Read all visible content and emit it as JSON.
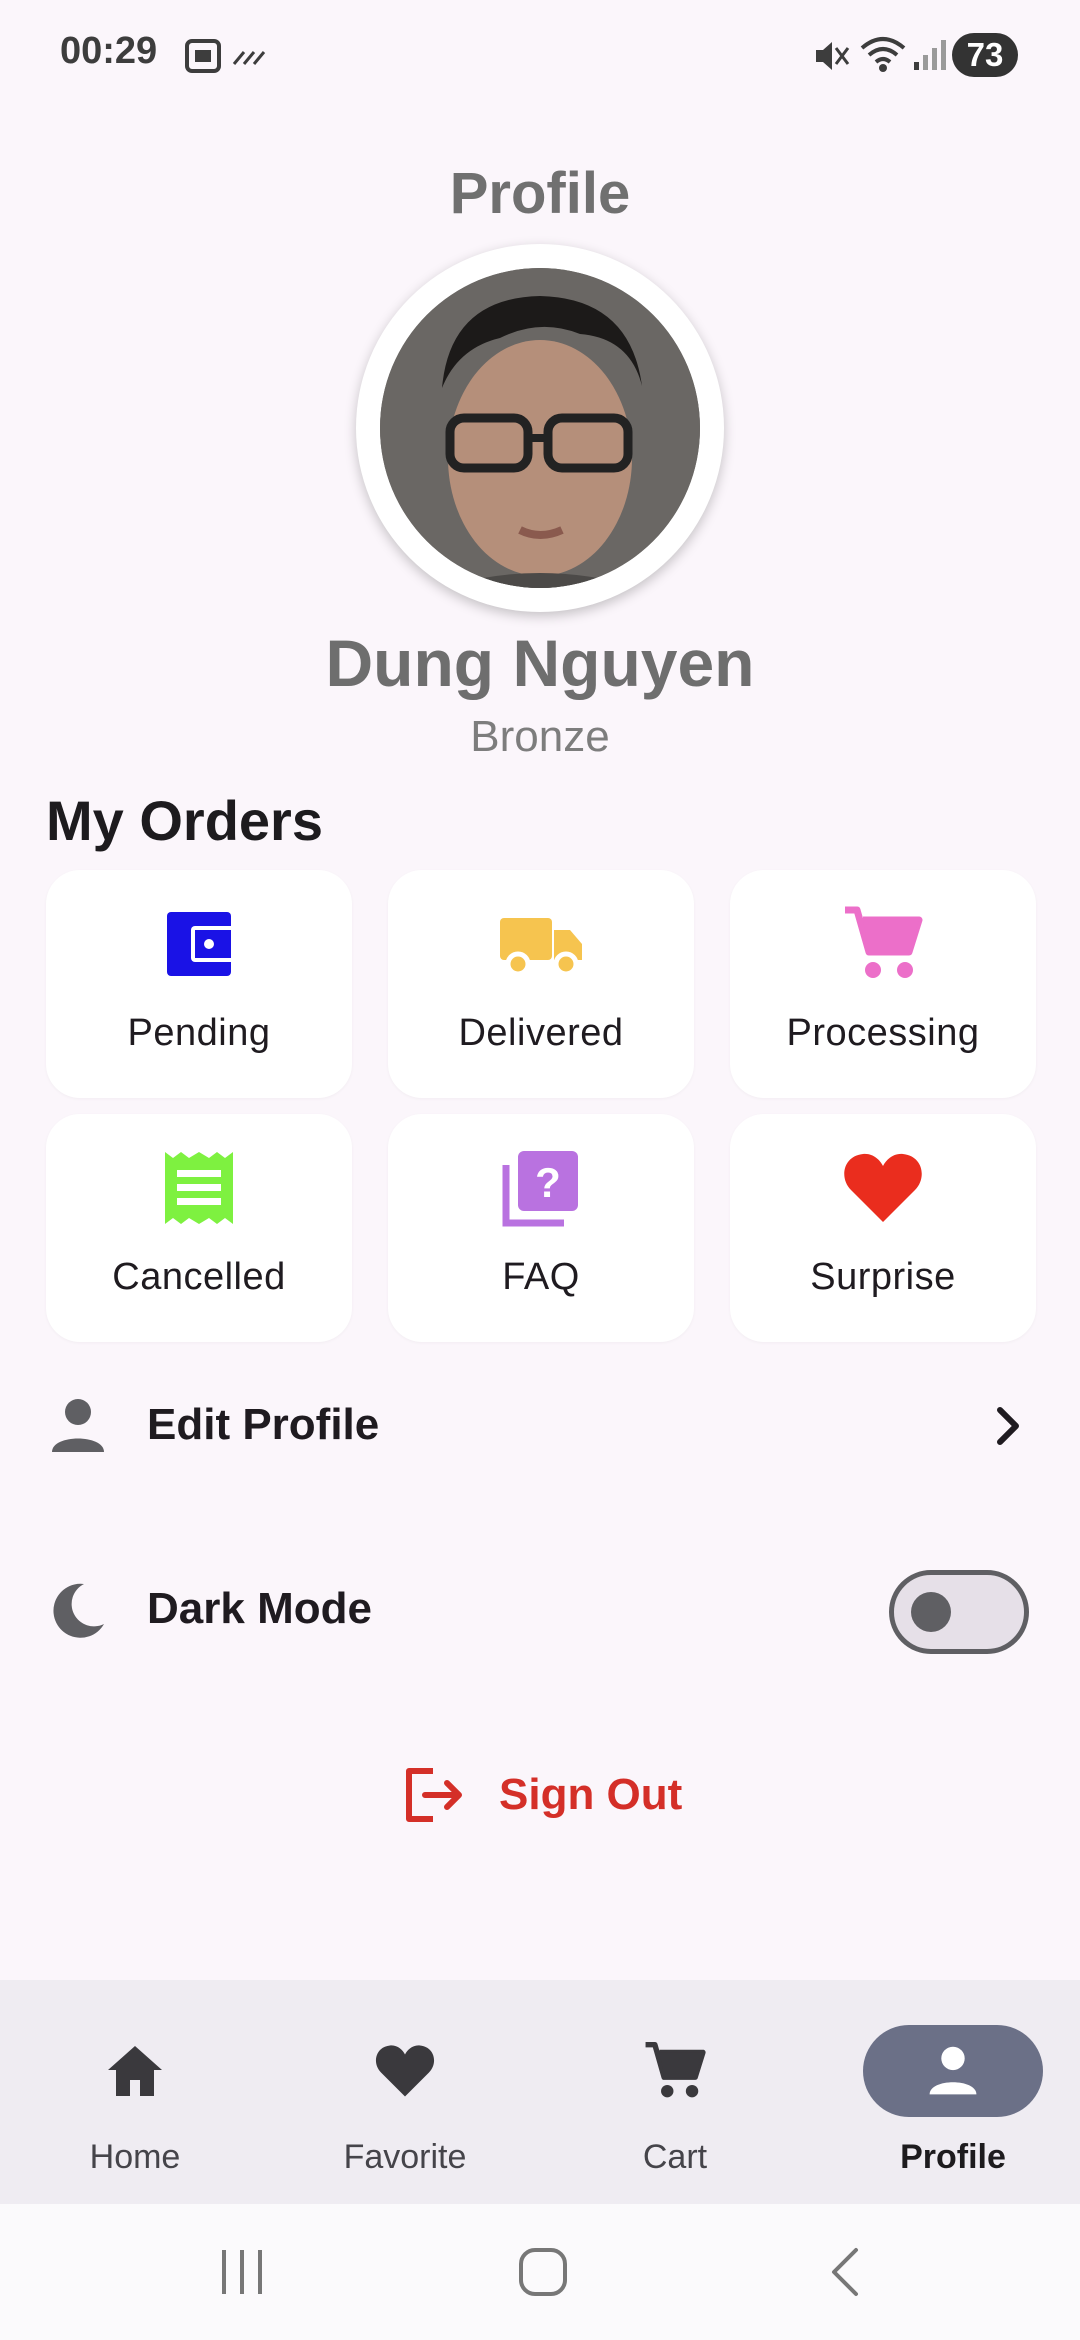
{
  "status_bar": {
    "time": "00:29",
    "battery": "73"
  },
  "header": {
    "title": "Profile"
  },
  "user": {
    "name": "Dung Nguyen",
    "tier": "Bronze"
  },
  "orders": {
    "title": "My Orders",
    "items": [
      {
        "label": "Pending",
        "icon": "wallet-icon",
        "color": "#1a12e6"
      },
      {
        "label": "Delivered",
        "icon": "truck-icon",
        "color": "#f6c44f"
      },
      {
        "label": "Processing",
        "icon": "cart-icon",
        "color": "#ec6fc9"
      },
      {
        "label": "Cancelled",
        "icon": "receipt-icon",
        "color": "#7ef140"
      },
      {
        "label": "FAQ",
        "icon": "question-icon",
        "color": "#b972e0"
      },
      {
        "label": "Surprise",
        "icon": "heart-icon",
        "color": "#ea2d1e"
      }
    ]
  },
  "settings": {
    "edit_profile": "Edit Profile",
    "dark_mode": "Dark Mode",
    "dark_mode_enabled": false
  },
  "sign_out": {
    "label": "Sign Out",
    "color": "#d42f28"
  },
  "bottom_nav": {
    "items": [
      {
        "label": "Home",
        "icon": "home-icon"
      },
      {
        "label": "Favorite",
        "icon": "heart-icon"
      },
      {
        "label": "Cart",
        "icon": "cart-icon"
      },
      {
        "label": "Profile",
        "icon": "person-icon"
      }
    ],
    "active": "Profile",
    "active_color": "#6b7087"
  }
}
